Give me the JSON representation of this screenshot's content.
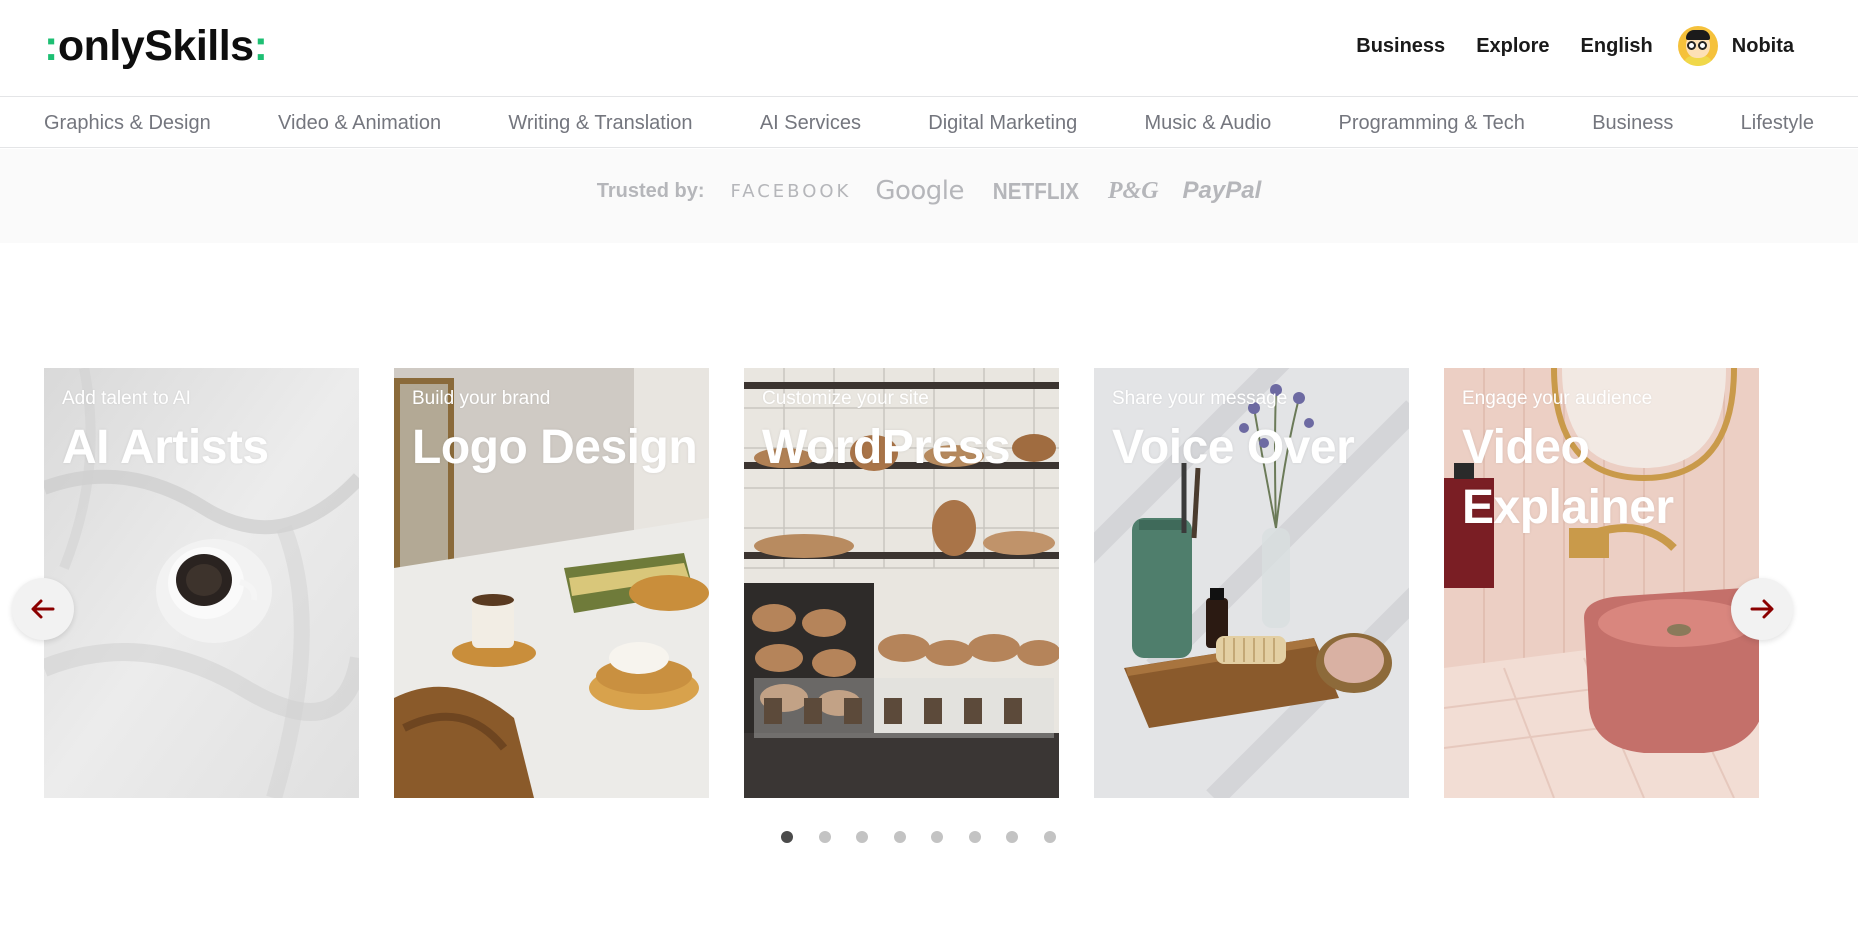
{
  "header": {
    "logo": {
      "prefix": ":",
      "name": "onlySkills",
      "suffix": ":",
      "accent_color": "#1dbf73"
    },
    "nav": {
      "business": "Business",
      "explore": "Explore",
      "language": "English",
      "user_name": "Nobita",
      "avatar_icon": "avatar-cartoon-icon"
    }
  },
  "categories": [
    "Graphics & Design",
    "Video & Animation",
    "Writing & Translation",
    "AI Services",
    "Digital Marketing",
    "Music & Audio",
    "Programming & Tech",
    "Business",
    "Lifestyle"
  ],
  "trusted": {
    "label": "Trusted by:",
    "brands": [
      "FACEBOOK",
      "Google",
      "NETFLIX",
      "P&G",
      "PayPal"
    ]
  },
  "carousel": {
    "prev_icon": "arrow-left-icon",
    "next_icon": "arrow-right-icon",
    "arrow_color": "#8b0000",
    "cards": [
      {
        "subtitle": "Add talent to AI",
        "title": "AI Artists"
      },
      {
        "subtitle": "Build your brand",
        "title": "Logo Design"
      },
      {
        "subtitle": "Customize your site",
        "title": "WordPress"
      },
      {
        "subtitle": "Share your message",
        "title": "Voice Over"
      },
      {
        "subtitle": "Engage your audience",
        "title": "Video Explainer"
      }
    ],
    "dots_total": 8,
    "active_dot": 1
  }
}
